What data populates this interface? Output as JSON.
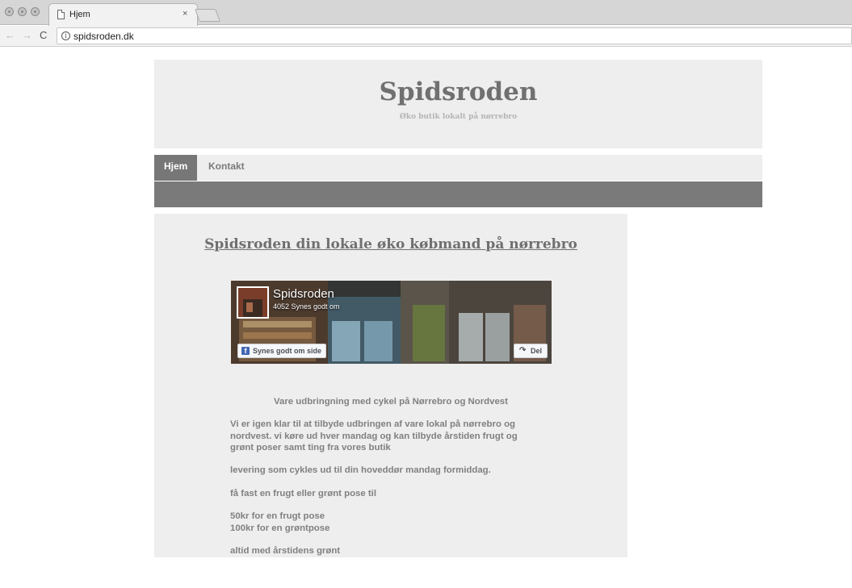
{
  "browser": {
    "tab_title": "Hjem",
    "tab_close": "×",
    "url": "spidsroden.dk",
    "back": "←",
    "forward": "→",
    "reload": "C"
  },
  "header": {
    "title": "Spidsroden",
    "tagline": "Øko butik lokalt på nørrebro"
  },
  "nav": {
    "items": [
      {
        "label": "Hjem",
        "active": true
      },
      {
        "label": "Kontakt",
        "active": false
      }
    ]
  },
  "content": {
    "heading": "Spidsroden din lokale øko købmand på nørrebro",
    "facebook": {
      "page_name": "Spidsroden",
      "likes": "4052 Synes godt om",
      "like_button": "Synes godt om side",
      "share_button": "Del"
    },
    "paragraphs": [
      "Vare udbringning med cykel på Nørrebro og Nordvest",
      "Vi er igen klar til at tilbyde udbringen af vare lokal på nørrebro og",
      "nordvest. vi køre ud hver mandag og kan tilbyde årstiden frugt og",
      "grønt poser samt ting fra vores butik",
      "levering som cykles ud til din hoveddør mandag formiddag.",
      "få fast en frugt eller grønt pose til",
      "50kr for en frugt pose",
      "100kr for en grøntpose",
      "altid med årstidens grønt"
    ]
  }
}
